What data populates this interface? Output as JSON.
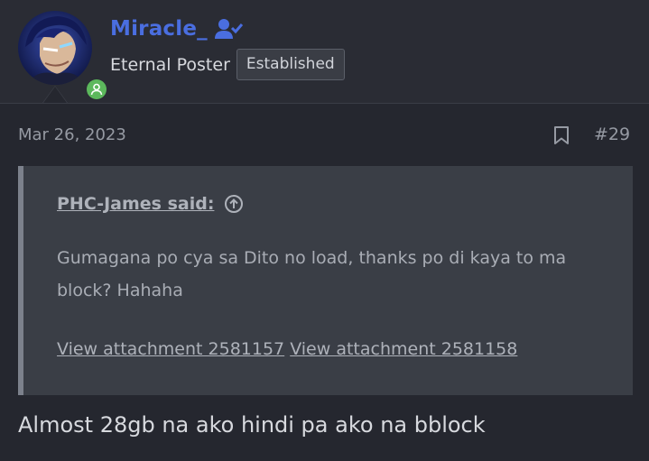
{
  "user": {
    "username": "Miracle_",
    "title": "Eternal Poster",
    "badge": "Established"
  },
  "post": {
    "date": "Mar 26, 2023",
    "number": "#29",
    "message": "Almost 28gb na ako hindi pa ako na bblock"
  },
  "quote": {
    "author_said": "PHC-James said:",
    "body": "Gumagana po cya sa Dito no load, thanks po di kaya to ma block? Hahaha",
    "attachments": [
      "View attachment 2581157",
      "View attachment 2581158"
    ]
  },
  "icons": {
    "verified": "user-check-icon",
    "bookmark": "bookmark-icon",
    "jump": "arrow-circle-up-icon",
    "online": "user-online-icon"
  },
  "colors": {
    "username": "#4a6ee0",
    "online": "#5cb85c",
    "background": "#25272f",
    "quote_bg": "#3a3e46"
  }
}
